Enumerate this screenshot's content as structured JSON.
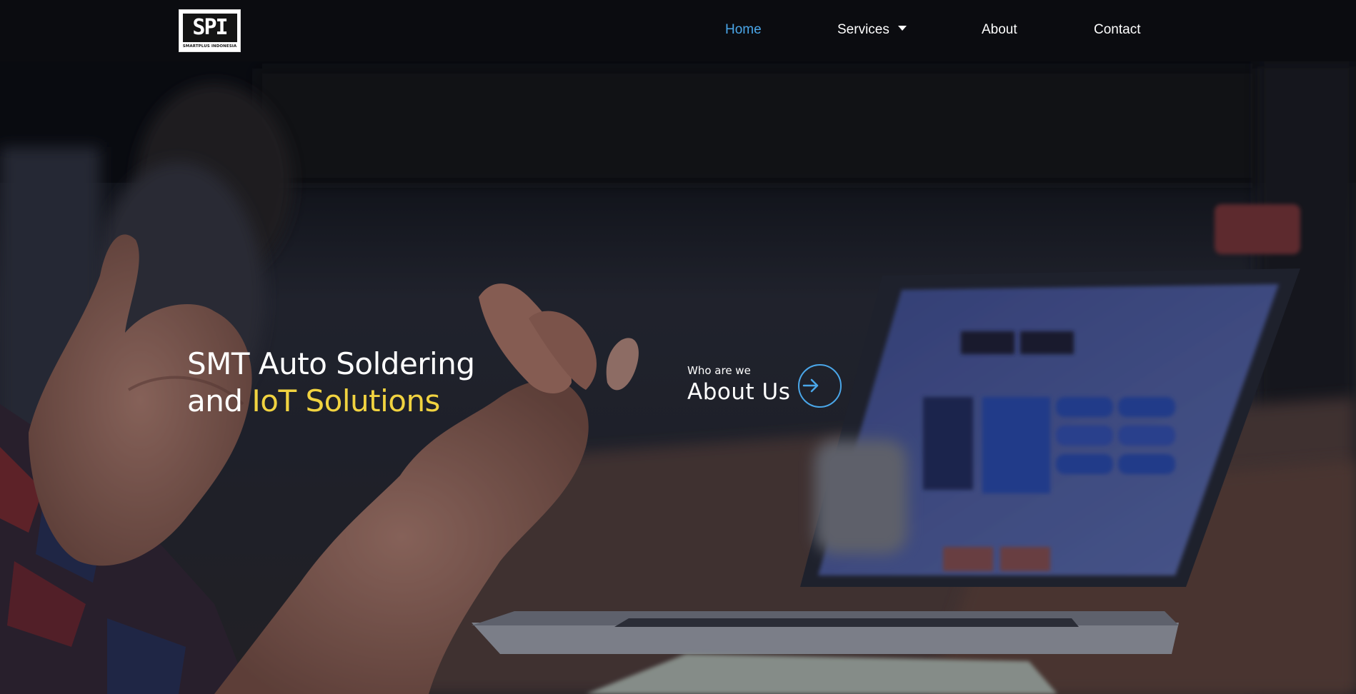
{
  "header": {
    "logo": {
      "mark": "SPI",
      "text": "SMARTPLUS INDONESIA"
    },
    "nav": [
      {
        "label": "Home",
        "active": true
      },
      {
        "label": "Services",
        "has_dropdown": true
      },
      {
        "label": "About"
      },
      {
        "label": "Contact"
      }
    ]
  },
  "hero": {
    "headline_line1": "SMT Auto Soldering",
    "headline_line2_prefix": "and ",
    "headline_line2_accent": "IoT Solutions",
    "about_eyebrow": "Who are we",
    "about_title": "About Us",
    "about_icon": "arrow-right-circle-icon"
  },
  "colors": {
    "accent_blue": "#4aa6e8",
    "accent_yellow": "#f1d340",
    "header_bg": "#0b0c10"
  }
}
